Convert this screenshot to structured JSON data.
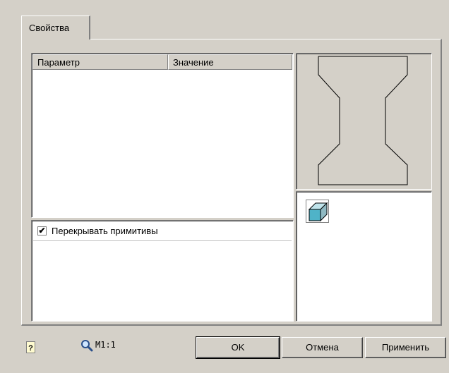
{
  "tabs": [
    {
      "label": "Свойства"
    }
  ],
  "properties": {
    "columns": [
      "Параметр",
      "Значение"
    ],
    "rows": []
  },
  "options": {
    "overlap_primitives": {
      "label": "Перекрывать примитивы",
      "checked": true
    }
  },
  "footer": {
    "scale_label": "M1:1",
    "ok_label": "OK",
    "cancel_label": "Отмена",
    "apply_label": "Применить"
  },
  "icons": {
    "help": "help-icon",
    "zoom": "magnifier-icon",
    "cube": "cube-icon"
  }
}
